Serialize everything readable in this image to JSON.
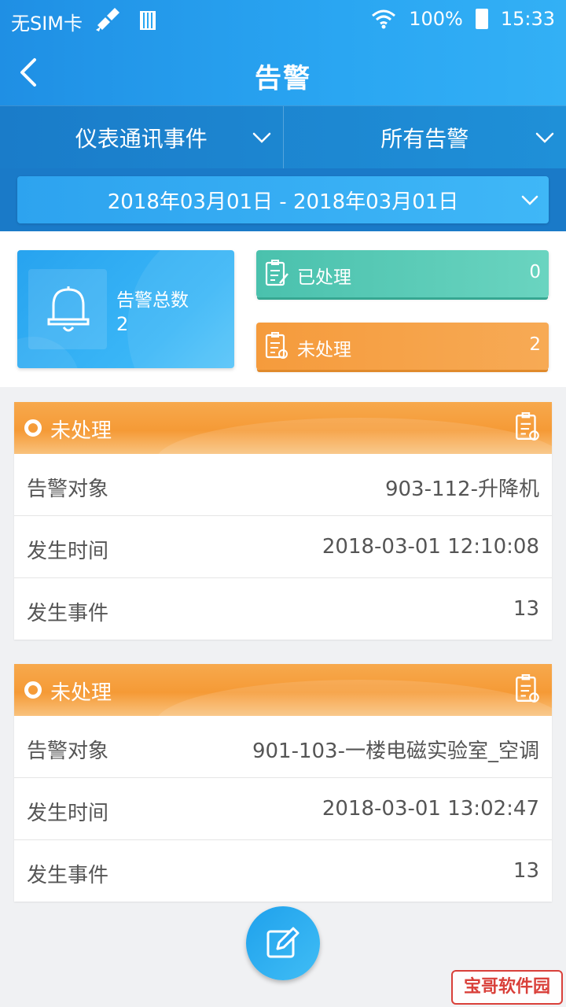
{
  "status_bar": {
    "carrier": "无SIM卡",
    "battery": "100%",
    "time": "15:33"
  },
  "header": {
    "title": "告警"
  },
  "filters": [
    {
      "label": "仪表通讯事件"
    },
    {
      "label": "所有告警"
    }
  ],
  "date_range": "2018年03月01日 - 2018年03月01日",
  "summary": {
    "total_label": "告警总数",
    "total_value": "2",
    "processed": {
      "label": "已处理",
      "count": "0",
      "color": "#4ac1ad"
    },
    "unprocessed": {
      "label": "未处理",
      "count": "2",
      "color": "#f59b3c"
    }
  },
  "alarms": [
    {
      "status": "未处理",
      "rows": [
        {
          "label": "告警对象",
          "value": "903-112-升降机"
        },
        {
          "label": "发生时间",
          "value": "2018-03-01 12:10:08"
        },
        {
          "label": "发生事件",
          "value": "13"
        }
      ]
    },
    {
      "status": "未处理",
      "rows": [
        {
          "label": "告警对象",
          "value": "901-103-一楼电磁实验室_空调"
        },
        {
          "label": "发生时间",
          "value": "2018-03-01 13:02:47"
        },
        {
          "label": "发生事件",
          "value": "13"
        }
      ]
    }
  ],
  "watermark": "宝哥软件园",
  "colors": {
    "primary": "#2aa6f2",
    "header_dark": "#1a7cc9",
    "warning": "#f59b3c",
    "success": "#4ac1ad"
  }
}
